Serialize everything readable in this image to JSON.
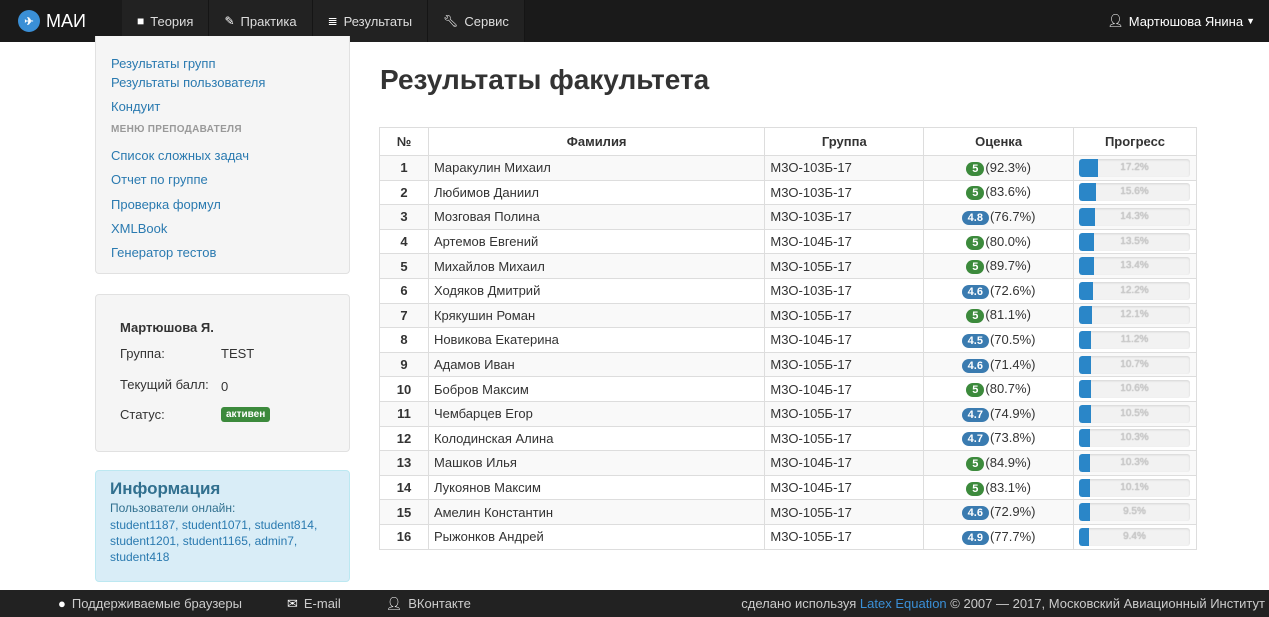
{
  "navbar": {
    "brand": "МАИ",
    "items": [
      {
        "label": "Теория",
        "icon": "book-icon"
      },
      {
        "label": "Практика",
        "icon": "pencil-icon"
      },
      {
        "label": "Результаты",
        "icon": "list-icon"
      },
      {
        "label": "Сервис",
        "icon": "wrench-icon"
      }
    ],
    "user": "Мартюшова Янина"
  },
  "sidebar": {
    "menu": [
      {
        "label": "Результаты групп"
      },
      {
        "label": "Результаты пользователя"
      },
      {
        "label": "Кондуит"
      }
    ],
    "teacher_header": "МЕНЮ ПРЕПОДАВАТЕЛЯ",
    "teacher_menu": [
      {
        "label": "Список сложных задач"
      },
      {
        "label": "Отчет по группе"
      },
      {
        "label": "Проверка формул"
      },
      {
        "label": "XMLBook"
      },
      {
        "label": "Генератор тестов"
      }
    ],
    "user_panel": {
      "name": "Мартюшова Я.",
      "group_label": "Группа:",
      "group_value": "TEST",
      "score_label": "Текущий балл:",
      "score_value": "0",
      "status_label": "Статус:",
      "status_value": "активен"
    },
    "info": {
      "title": "Информация",
      "online_label": "Пользователи онлайн:",
      "online_users": "student1187, student1071, student814, student1201, student1165, admin7, student418"
    }
  },
  "main": {
    "title": "Результаты факультета",
    "columns": [
      "№",
      "Фамилия",
      "Группа",
      "Оценка",
      "Прогресс"
    ],
    "rows": [
      {
        "n": "1",
        "name": "Маракулин Михаил",
        "group": "М3О-103Б-17",
        "grade": "5",
        "pct": "(92.3%)",
        "progress": "17.2%",
        "p": 17.2,
        "color": "green"
      },
      {
        "n": "2",
        "name": "Любимов Даниил",
        "group": "М3О-103Б-17",
        "grade": "5",
        "pct": "(83.6%)",
        "progress": "15.6%",
        "p": 15.6,
        "color": "green"
      },
      {
        "n": "3",
        "name": "Мозговая Полина",
        "group": "М3О-103Б-17",
        "grade": "4.8",
        "pct": "(76.7%)",
        "progress": "14.3%",
        "p": 14.3,
        "color": "blue"
      },
      {
        "n": "4",
        "name": "Артемов Евгений",
        "group": "М3О-104Б-17",
        "grade": "5",
        "pct": "(80.0%)",
        "progress": "13.5%",
        "p": 13.5,
        "color": "green"
      },
      {
        "n": "5",
        "name": "Михайлов Михаил",
        "group": "М3О-105Б-17",
        "grade": "5",
        "pct": "(89.7%)",
        "progress": "13.4%",
        "p": 13.4,
        "color": "green"
      },
      {
        "n": "6",
        "name": "Ходяков Дмитрий",
        "group": "М3О-103Б-17",
        "grade": "4.6",
        "pct": "(72.6%)",
        "progress": "12.2%",
        "p": 12.2,
        "color": "blue"
      },
      {
        "n": "7",
        "name": "Крякушин Роман",
        "group": "М3О-105Б-17",
        "grade": "5",
        "pct": "(81.1%)",
        "progress": "12.1%",
        "p": 12.1,
        "color": "green"
      },
      {
        "n": "8",
        "name": "Новикова Екатерина",
        "group": "М3О-104Б-17",
        "grade": "4.5",
        "pct": "(70.5%)",
        "progress": "11.2%",
        "p": 11.2,
        "color": "blue"
      },
      {
        "n": "9",
        "name": "Адамов Иван",
        "group": "М3О-105Б-17",
        "grade": "4.6",
        "pct": "(71.4%)",
        "progress": "10.7%",
        "p": 10.7,
        "color": "blue"
      },
      {
        "n": "10",
        "name": "Бобров Максим",
        "group": "М3О-104Б-17",
        "grade": "5",
        "pct": "(80.7%)",
        "progress": "10.6%",
        "p": 10.6,
        "color": "green"
      },
      {
        "n": "11",
        "name": "Чембарцев Егор",
        "group": "М3О-105Б-17",
        "grade": "4.7",
        "pct": "(74.9%)",
        "progress": "10.5%",
        "p": 10.5,
        "color": "blue"
      },
      {
        "n": "12",
        "name": "Колодинская Алина",
        "group": "М3О-105Б-17",
        "grade": "4.7",
        "pct": "(73.8%)",
        "progress": "10.3%",
        "p": 10.3,
        "color": "blue"
      },
      {
        "n": "13",
        "name": "Машков Илья",
        "group": "М3О-104Б-17",
        "grade": "5",
        "pct": "(84.9%)",
        "progress": "10.3%",
        "p": 10.3,
        "color": "green"
      },
      {
        "n": "14",
        "name": "Лукоянов Максим",
        "group": "М3О-104Б-17",
        "grade": "5",
        "pct": "(83.1%)",
        "progress": "10.1%",
        "p": 10.1,
        "color": "green"
      },
      {
        "n": "15",
        "name": "Амелин Константин",
        "group": "М3О-105Б-17",
        "grade": "4.6",
        "pct": "(72.9%)",
        "progress": "9.5%",
        "p": 9.5,
        "color": "blue"
      },
      {
        "n": "16",
        "name": "Рыжонков Андрей",
        "group": "М3О-105Б-17",
        "grade": "4.9",
        "pct": "(77.7%)",
        "progress": "9.4%",
        "p": 9.4,
        "color": "blue"
      }
    ]
  },
  "footer": {
    "browsers": "Поддерживаемые браузеры",
    "email": "E-mail",
    "vk": "ВКонтакте",
    "credit_prefix": "сделано используя",
    "credit_link": "Latex Equation",
    "credit_suffix": "© 2007 — 2017, Московский Авиационный Институт"
  },
  "colors": {
    "navbar": "#1a1a1a",
    "link": "#2a7ab0",
    "grade_green": "#3c8a3c",
    "grade_blue": "#3a7bb0",
    "progress": "#2a86c8"
  }
}
